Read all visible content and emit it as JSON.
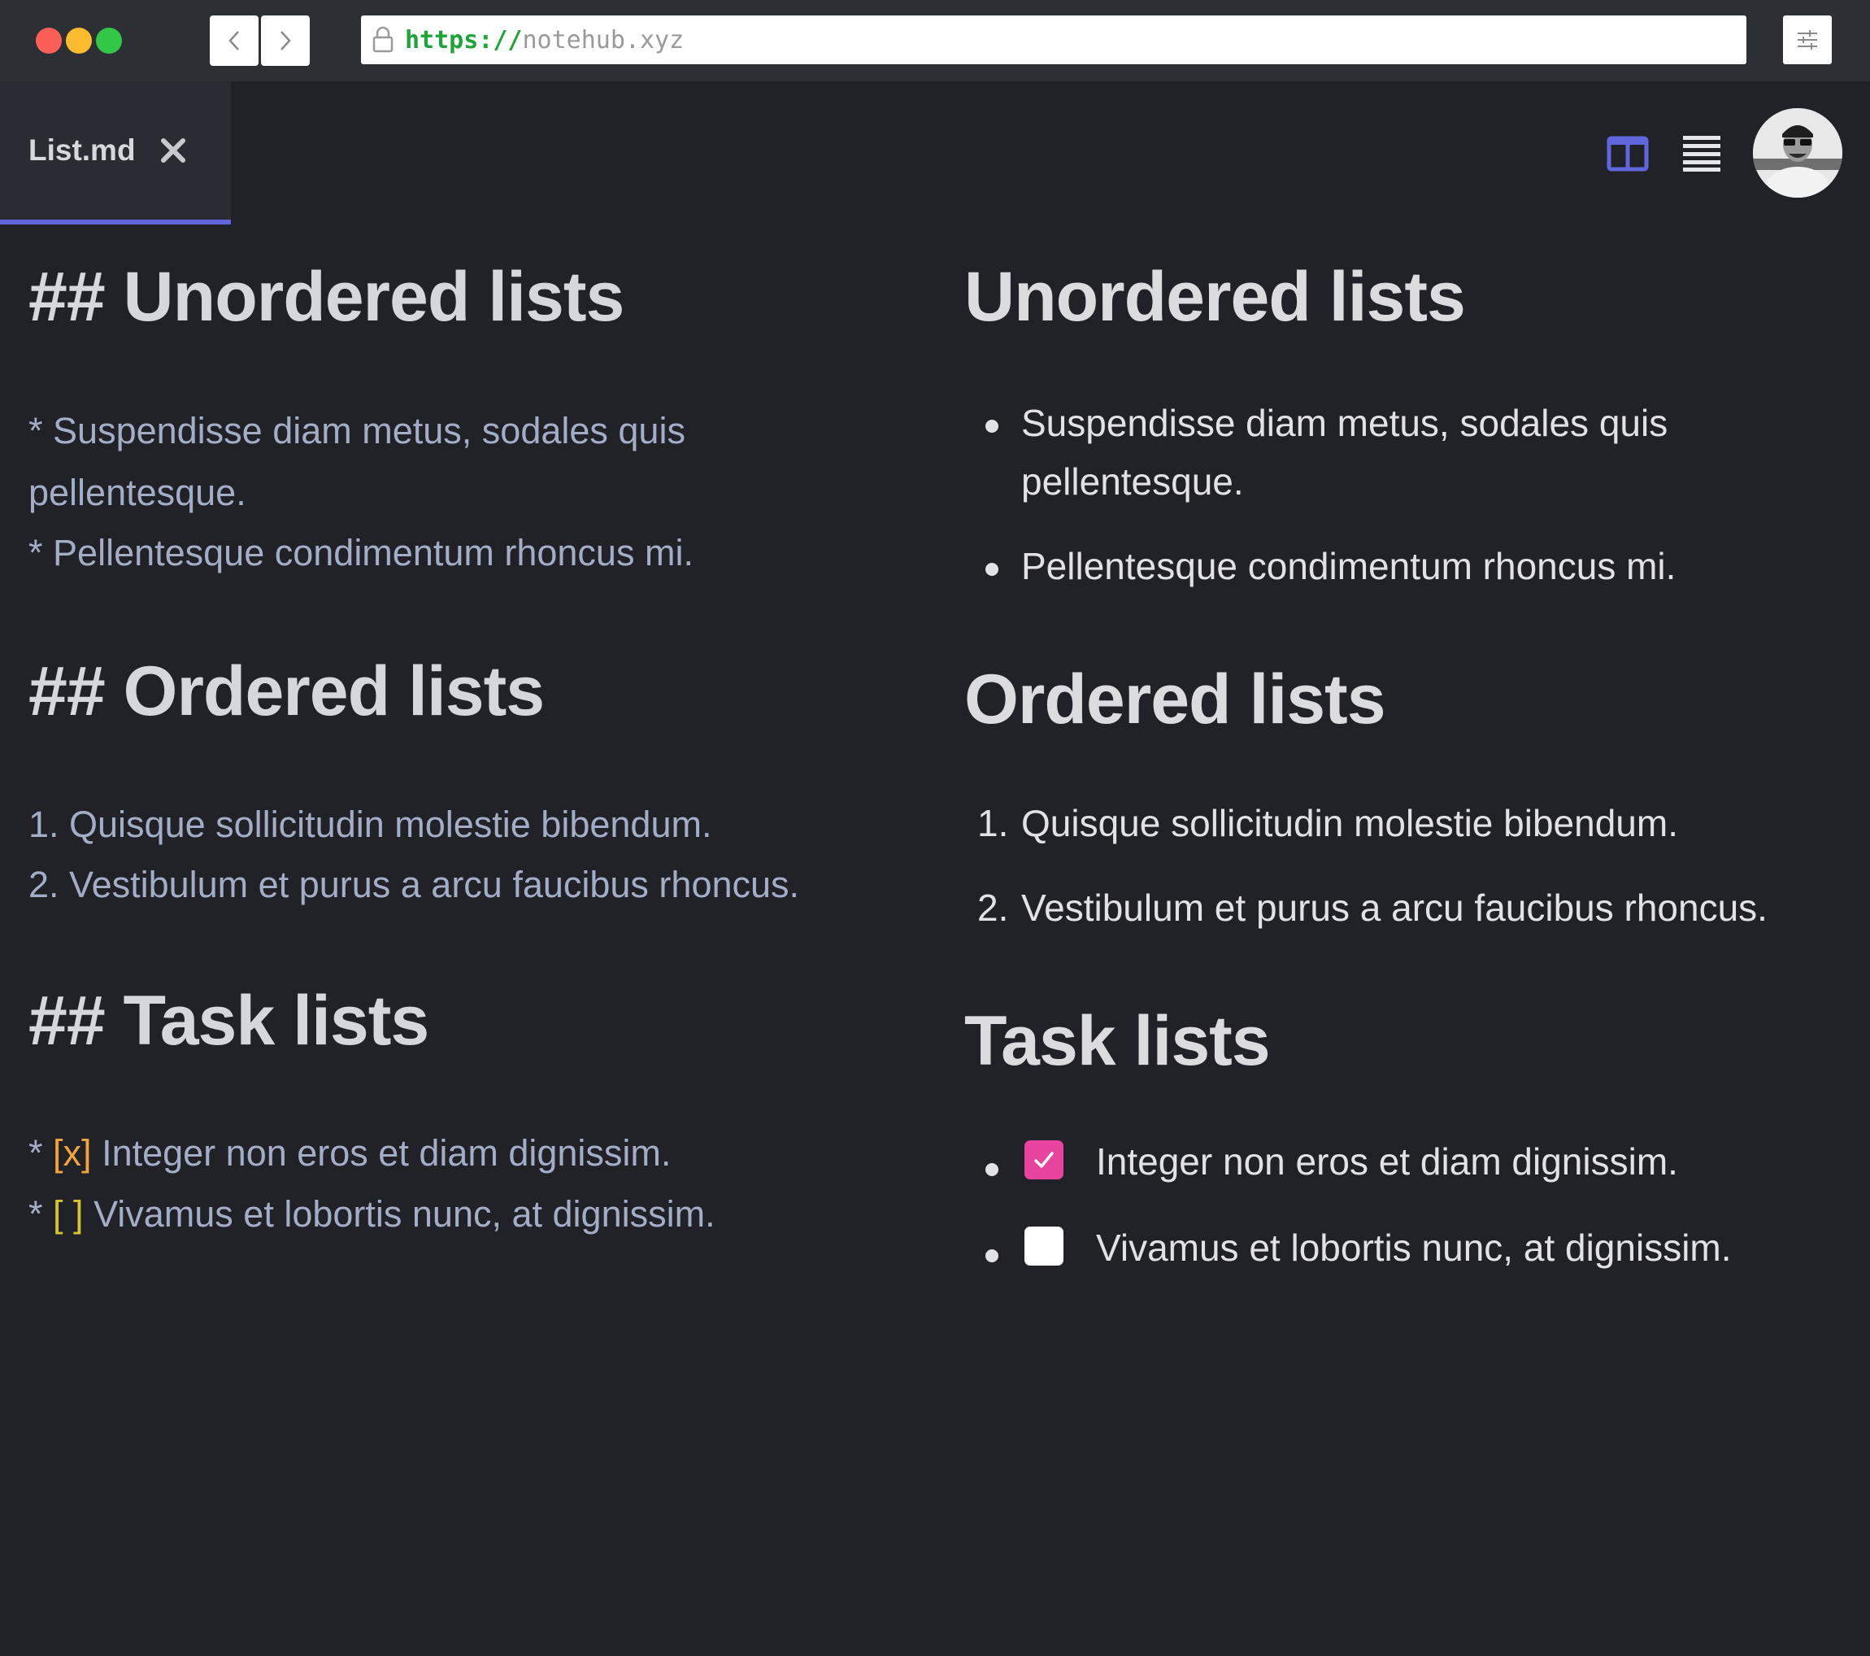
{
  "browser": {
    "url_scheme": "https://",
    "url_host": "notehub.xyz",
    "traffic_light_colors": [
      "#fc5f57",
      "#fdbc2e",
      "#33c748"
    ]
  },
  "tab": {
    "filename": "List.md",
    "accent_color": "#6266dc"
  },
  "toolbar": {
    "icons": [
      "split-view-icon",
      "list-view-icon"
    ],
    "active_view": "split"
  },
  "editor": {
    "h_unordered": "## Unordered lists",
    "unordered_lines": [
      {
        "marker": "*",
        "text": "Suspendisse diam metus, sodales quis"
      },
      {
        "marker": "",
        "text": "pellentesque."
      },
      {
        "marker": "*",
        "text": "Pellentesque condimentum rhoncus mi."
      }
    ],
    "h_ordered": "## Ordered lists",
    "ordered_lines": [
      "1. Quisque sollicitudin molestie bibendum.",
      "2. Vestibulum et purus a arcu faucibus rhoncus."
    ],
    "h_tasks": "## Task lists",
    "task_lines": [
      {
        "marker": "*",
        "box": "[x]",
        "text": "Integer non eros et diam dignissim."
      },
      {
        "marker": "*",
        "box": "[ ]",
        "text": "Vivamus et lobortis nunc, at dignissim."
      }
    ]
  },
  "preview": {
    "h_unordered": "Unordered lists",
    "unordered_items": [
      "Suspendisse diam metus, sodales quis",
      "pellentesque.",
      "Pellentesque condimentum rhoncus mi."
    ],
    "h_ordered": "Ordered lists",
    "ordered_items": [
      {
        "num": "1.",
        "text": "Quisque sollicitudin molestie bibendum."
      },
      {
        "num": "2.",
        "text": "Vestibulum et purus a arcu faucibus rhoncus."
      }
    ],
    "h_tasks": "Task lists",
    "task_items": [
      {
        "checked": true,
        "text": "Integer non eros et diam dignissim."
      },
      {
        "checked": false,
        "text": "Vivamus et lobortis nunc, at dignissim."
      }
    ],
    "checkbox_checked_color": "#e8439e"
  }
}
